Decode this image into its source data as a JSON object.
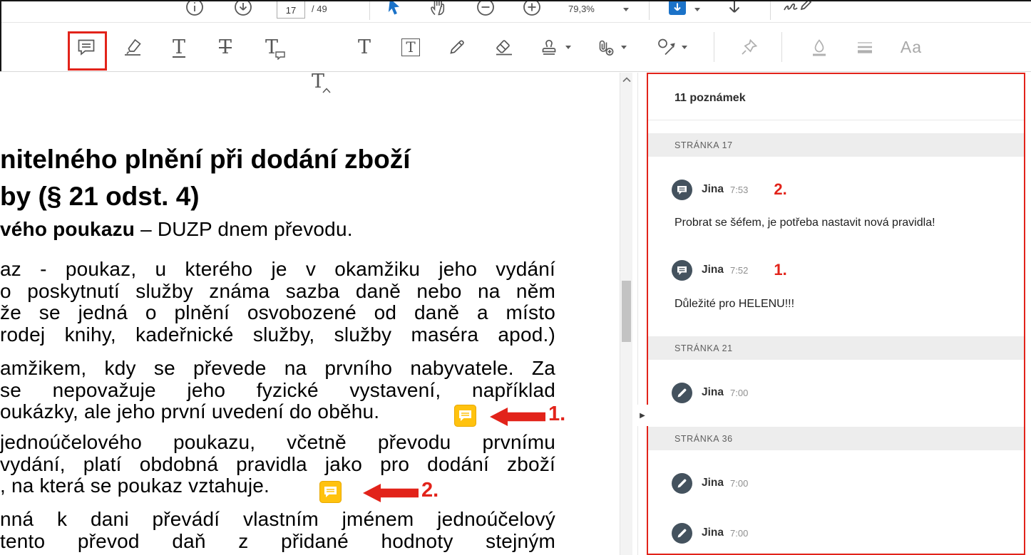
{
  "colors": {
    "accent_red": "#e2231a",
    "note_yellow": "#ffc20e",
    "toolbar_icon": "#585858",
    "disabled_icon": "#b0b0b0",
    "selection_blue": "#1b72c8",
    "avatar_bg": "#44525e"
  },
  "top_toolbar": {
    "page_current": "17",
    "page_total": "/ 49",
    "zoom_value": "79,3%"
  },
  "glyphs": {
    "t": "T",
    "aa": "Aa"
  },
  "icons": {
    "top_row": [
      "info-icon",
      "download-icon",
      "select-tool-icon",
      "hand-tool-icon",
      "zoom-out-icon",
      "zoom-in-icon",
      "page-display-icon",
      "scroll-arrow-icon",
      "signature-icon"
    ],
    "comment_toolbar": [
      "sticky-note-icon",
      "highlight-icon",
      "underline-text-icon",
      "strikethrough-text-icon",
      "replace-text-icon",
      "insert-text-icon",
      "add-text-icon",
      "text-box-icon",
      "pencil-icon",
      "eraser-icon",
      "stamp-icon",
      "attach-file-icon",
      "drawing-tools-icon",
      "pin-icon",
      "fill-color-icon",
      "line-weight-icon",
      "text-appearance-icon"
    ],
    "panel": [
      "sticky-note-comment-icon",
      "pencil-comment-icon"
    ]
  },
  "document": {
    "heading_line1": "nitelného plnění při dodání zboží",
    "heading_line2": "by (§ 21 odst. 4)",
    "lead_bold": "vého poukazu",
    "lead_rest": " – DUZP dnem převodu.",
    "para1": [
      "az - poukaz, u kterého je v okamžiku jeho vydání",
      "o poskytnutí služby známa sazba daně nebo na něm",
      "že se jedná o plnění osvobozené od daně a místo",
      "rodej knihy, kadeřnické služby, služby maséra apod.)"
    ],
    "para2": [
      "amžikem, kdy se převede na prvního nabyvatele. Za",
      "se nepovažuje jeho fyzické vystavení, například",
      "oukázky, ale jeho první uvedení do oběhu."
    ],
    "para3": [
      "jednoúčelového poukazu, včetně převodu prvnímu",
      "vydání, platí obdobná pravidla jako pro dodání zboží",
      ", na která se poukaz vztahuje."
    ],
    "para4": [
      "nná k dani převádí vlastním jménem jednoúčelový",
      "tento převod daň z přidané hodnoty stejným"
    ],
    "marker1": "1.",
    "marker2": "2."
  },
  "comments_panel": {
    "title": "11 poznámek",
    "sections": [
      {
        "label": "STRÁNKA 17",
        "comments": [
          {
            "icon": "sticky-note",
            "author": "Jina",
            "time": "7:53",
            "marker": "2.",
            "text": "Probrat se šéfem, je potřeba nastavit nová pravidla!"
          },
          {
            "icon": "sticky-note",
            "author": "Jina",
            "time": "7:52",
            "marker": "1.",
            "text": "Důležité pro HELENU!!!"
          }
        ]
      },
      {
        "label": "STRÁNKA 21",
        "comments": [
          {
            "icon": "pencil",
            "author": "Jina",
            "time": "7:00"
          }
        ]
      },
      {
        "label": "STRÁNKA 36",
        "comments": [
          {
            "icon": "pencil",
            "author": "Jina",
            "time": "7:00"
          },
          {
            "icon": "pencil",
            "author": "Jina",
            "time": "7:00"
          }
        ]
      }
    ]
  }
}
